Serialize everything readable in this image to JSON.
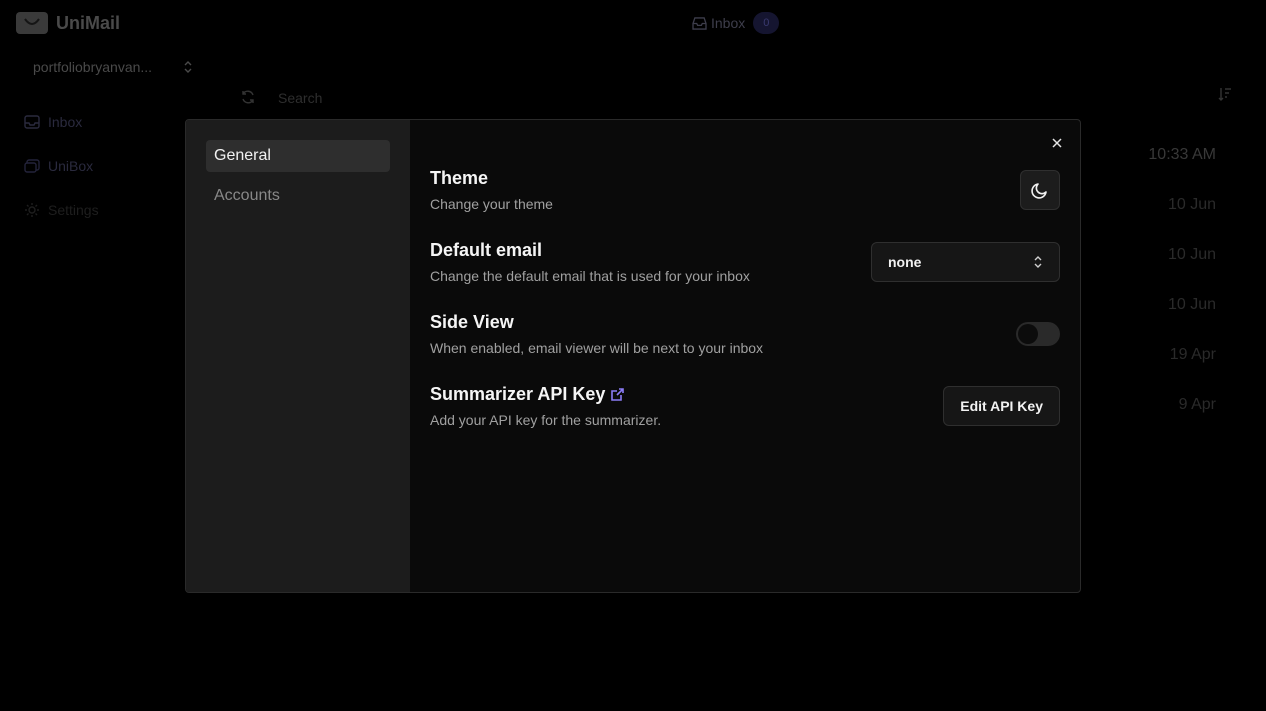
{
  "app": {
    "name": "UniMail",
    "top_inbox_label": "Inbox",
    "top_inbox_count": "0",
    "account": "portfoliobryanvan...",
    "nav": [
      {
        "label": "Inbox"
      },
      {
        "label": "UniBox"
      },
      {
        "label": "Settings"
      }
    ],
    "search_placeholder": "Search",
    "dates": [
      "10:33 AM",
      "10 Jun",
      "10 Jun",
      "10 Jun",
      "19 Apr",
      "9 Apr"
    ]
  },
  "settings": {
    "tabs": [
      {
        "label": "General",
        "active": true
      },
      {
        "label": "Accounts",
        "active": false
      }
    ],
    "theme": {
      "title": "Theme",
      "desc": "Change your theme",
      "icon": "moon-icon"
    },
    "default_email": {
      "title": "Default email",
      "desc": "Change the default email that is used for your inbox",
      "value": "none"
    },
    "side_view": {
      "title": "Side View",
      "desc": "When enabled, email viewer will be next to your inbox",
      "enabled": false
    },
    "api_key": {
      "title": "Summarizer API Key",
      "desc": "Add your API key for the summarizer.",
      "button": "Edit API Key",
      "link_color": "#8b7cf6"
    }
  }
}
